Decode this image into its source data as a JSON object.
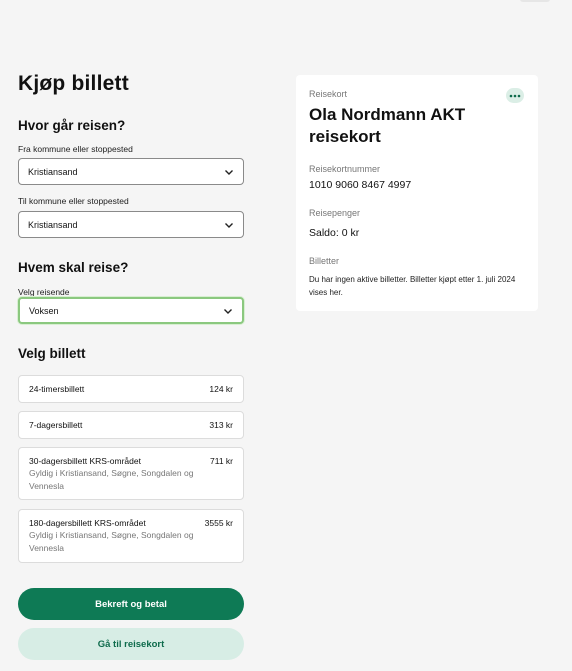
{
  "purchase": {
    "title": "Kjøp billett",
    "route_heading": "Hvor går reisen?",
    "from_label": "Fra kommune eller stoppested",
    "from_value": "Kristiansand",
    "to_label": "Til kommune eller stoppested",
    "to_value": "Kristiansand",
    "traveler_heading": "Hvem skal reise?",
    "traveler_label": "Velg reisende",
    "traveler_value": "Voksen",
    "ticket_heading": "Velg billett",
    "tickets": [
      {
        "name": "24-timersbillett",
        "price": "124 kr",
        "desc": ""
      },
      {
        "name": "7-dagersbillett",
        "price": "313 kr",
        "desc": ""
      },
      {
        "name": "30-dagersbillett KRS-området",
        "price": "711 kr",
        "desc": "Gyldig i Kristiansand, Søgne, Songdalen og Vennesla"
      },
      {
        "name": "180-dagersbillett KRS-området",
        "price": "3555 kr",
        "desc": "Gyldig i Kristiansand, Søgne, Songdalen og Vennesla"
      }
    ],
    "confirm_label": "Bekreft og betal",
    "goto_card_label": "Gå til reisekort"
  },
  "card": {
    "section_label": "Reisekort",
    "name": "Ola Nordmann AKT reisekort",
    "number_label": "Reisekortnummer",
    "number": "1010 9060 8467 4997",
    "money_label": "Reisepenger",
    "balance": "Saldo: 0 kr",
    "tickets_label": "Billetter",
    "tickets_note": "Du har ingen aktive billetter. Billetter kjøpt etter 1. juli 2024 vises her."
  },
  "icons": {
    "select": "chevron-down-icon",
    "more": "more-dots-icon"
  },
  "colors": {
    "primary": "#0e7a55",
    "secondary_bg": "#d7ede5",
    "focus_border": "#8bc87f",
    "page_bg": "#f5f5f5"
  }
}
